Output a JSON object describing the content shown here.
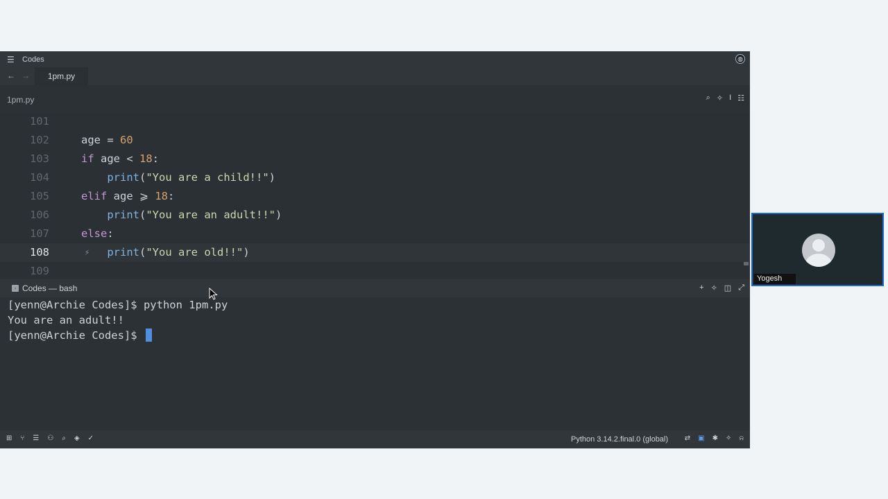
{
  "window": {
    "title": "Codes"
  },
  "tabs": [
    {
      "label": "1pm.py"
    }
  ],
  "breadcrumb": "1pm.py",
  "editor": {
    "lines": [
      {
        "num": "101",
        "tokens": []
      },
      {
        "num": "102",
        "tokens": [
          {
            "t": "age ",
            "c": "plain"
          },
          {
            "t": "= ",
            "c": "op"
          },
          {
            "t": "60",
            "c": "num"
          }
        ]
      },
      {
        "num": "103",
        "tokens": [
          {
            "t": "if ",
            "c": "kw"
          },
          {
            "t": "age ",
            "c": "plain"
          },
          {
            "t": "< ",
            "c": "op"
          },
          {
            "t": "18",
            "c": "num"
          },
          {
            "t": ":",
            "c": "plain"
          }
        ]
      },
      {
        "num": "104",
        "tokens": [
          {
            "t": "    ",
            "c": "plain"
          },
          {
            "t": "print",
            "c": "fn"
          },
          {
            "t": "(",
            "c": "plain"
          },
          {
            "t": "\"You are a child!!\"",
            "c": "str"
          },
          {
            "t": ")",
            "c": "plain"
          }
        ]
      },
      {
        "num": "105",
        "tokens": [
          {
            "t": "elif ",
            "c": "kw"
          },
          {
            "t": "age ",
            "c": "plain"
          },
          {
            "t": "⩾ ",
            "c": "op"
          },
          {
            "t": "18",
            "c": "num"
          },
          {
            "t": ":",
            "c": "plain"
          }
        ]
      },
      {
        "num": "106",
        "tokens": [
          {
            "t": "    ",
            "c": "plain"
          },
          {
            "t": "print",
            "c": "fn"
          },
          {
            "t": "(",
            "c": "plain"
          },
          {
            "t": "\"You are an adult!!\"",
            "c": "str"
          },
          {
            "t": ")",
            "c": "plain"
          }
        ]
      },
      {
        "num": "107",
        "tokens": [
          {
            "t": "else",
            "c": "kw"
          },
          {
            "t": ":",
            "c": "plain"
          }
        ]
      },
      {
        "num": "108",
        "current": true,
        "tokens": [
          {
            "t": "    ",
            "c": "plain"
          },
          {
            "t": "print",
            "c": "fn"
          },
          {
            "t": "(",
            "c": "plain"
          },
          {
            "t": "\"You are old!!\"",
            "c": "str"
          },
          {
            "t": ")",
            "c": "plain"
          }
        ]
      },
      {
        "num": "109",
        "tokens": []
      }
    ]
  },
  "terminal": {
    "tab_label": "Codes — bash",
    "lines": [
      "[yenn@Archie Codes]$ python 1pm.py",
      "You are an adult!!",
      "[yenn@Archie Codes]$ "
    ]
  },
  "statusbar": {
    "interpreter": "Python 3.14.2.final.0 (global)"
  },
  "video": {
    "participant": "Yogesh"
  },
  "colors": {
    "accent": "#1f68c9",
    "cursor": "#4f8fe0"
  },
  "icons": [
    "menu-icon",
    "globe-icon",
    "back-arrow-icon",
    "forward-arrow-icon",
    "search-icon",
    "magic-wand-icon",
    "text-cursor-icon",
    "sliders-icon",
    "terminal-icon",
    "plus-icon",
    "split-icon",
    "maximize-icon",
    "bolt-icon",
    "bell-icon",
    "bug-icon"
  ]
}
